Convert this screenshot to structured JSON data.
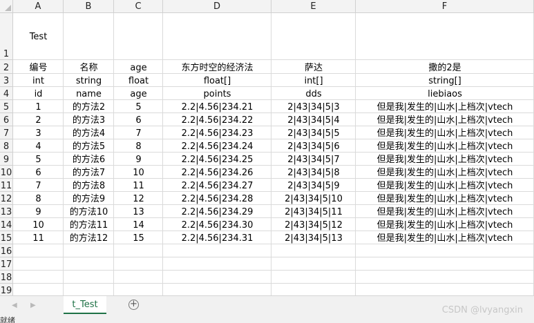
{
  "columns": [
    "A",
    "B",
    "C",
    "D",
    "E",
    "F"
  ],
  "row_numbers": [
    "1",
    "2",
    "3",
    "4",
    "5",
    "6",
    "7",
    "8",
    "9",
    "10",
    "11",
    "12",
    "13",
    "14",
    "15",
    "16",
    "17",
    "18",
    "19"
  ],
  "title_cell": "Test",
  "header_rows": [
    [
      "编号",
      "名称",
      "age",
      "东方时空的经济法",
      "萨达",
      "撒的2是"
    ],
    [
      "int",
      "string",
      "float",
      "float[]",
      "int[]",
      "string[]"
    ],
    [
      "id",
      "name",
      "age",
      "points",
      "dds",
      "liebiaos"
    ]
  ],
  "data_rows": [
    [
      "1",
      "的方法2",
      "5",
      "2.2|4.56|234.21",
      "2|43|34|5|3",
      "但是我|发生的|山水|上档次|vtech"
    ],
    [
      "2",
      "的方法3",
      "6",
      "2.2|4.56|234.22",
      "2|43|34|5|4",
      "但是我|发生的|山水|上档次|vtech"
    ],
    [
      "3",
      "的方法4",
      "7",
      "2.2|4.56|234.23",
      "2|43|34|5|5",
      "但是我|发生的|山水|上档次|vtech"
    ],
    [
      "4",
      "的方法5",
      "8",
      "2.2|4.56|234.24",
      "2|43|34|5|6",
      "但是我|发生的|山水|上档次|vtech"
    ],
    [
      "5",
      "的方法6",
      "9",
      "2.2|4.56|234.25",
      "2|43|34|5|7",
      "但是我|发生的|山水|上档次|vtech"
    ],
    [
      "6",
      "的方法7",
      "10",
      "2.2|4.56|234.26",
      "2|43|34|5|8",
      "但是我|发生的|山水|上档次|vtech"
    ],
    [
      "7",
      "的方法8",
      "11",
      "2.2|4.56|234.27",
      "2|43|34|5|9",
      "但是我|发生的|山水|上档次|vtech"
    ],
    [
      "8",
      "的方法9",
      "12",
      "2.2|4.56|234.28",
      "2|43|34|5|10",
      "但是我|发生的|山水|上档次|vtech"
    ],
    [
      "9",
      "的方法10",
      "13",
      "2.2|4.56|234.29",
      "2|43|34|5|11",
      "但是我|发生的|山水|上档次|vtech"
    ],
    [
      "10",
      "的方法11",
      "14",
      "2.2|4.56|234.30",
      "2|43|34|5|12",
      "但是我|发生的|山水|上档次|vtech"
    ],
    [
      "11",
      "的方法12",
      "15",
      "2.2|4.56|234.31",
      "2|43|34|5|13",
      "但是我|发生的|山水|上档次|vtech"
    ]
  ],
  "sheet_tab": "t_Test",
  "add_sheet_icon": "plus-circle-icon",
  "watermark": "CSDN @lvyangxin",
  "status_text": "就绪",
  "colors": {
    "accent": "#1e7145",
    "grid": "#dadada",
    "header_bg": "#f3f3f3"
  }
}
